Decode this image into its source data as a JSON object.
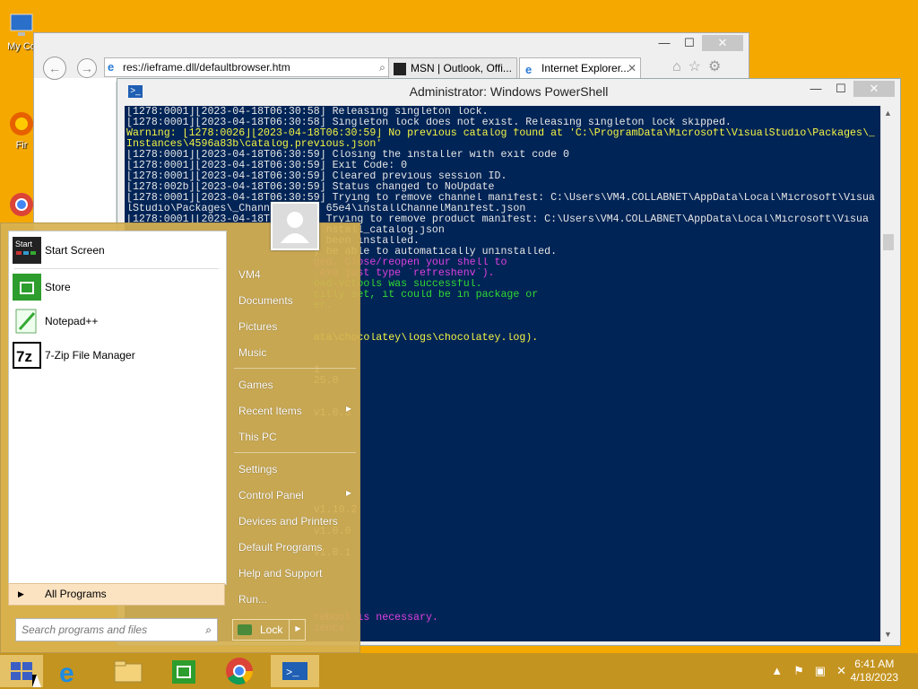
{
  "desktop": {
    "icons": [
      {
        "label": "My Co"
      },
      {
        "label": "Fir"
      }
    ]
  },
  "ie": {
    "address": "res://ieframe.dll/defaultbrowser.htm",
    "tabs": [
      {
        "label": "MSN | Outlook, Offi..."
      },
      {
        "label": "Internet Explorer..."
      }
    ]
  },
  "powershell": {
    "title": "Administrator: Windows PowerShell",
    "lines": [
      {
        "c": "w",
        "t": "[1278:0001][2023-04-18T06:30:58] Releasing singleton lock."
      },
      {
        "c": "w",
        "t": "[1278:0001][2023-04-18T06:30:58] Singleton lock does not exist. Releasing singleton lock skipped."
      },
      {
        "c": "y",
        "t": "Warning: [1278:0026][2023-04-18T06:30:59] No previous catalog found at 'C:\\ProgramData\\Microsoft\\VisualStudio\\Packages\\_"
      },
      {
        "c": "y",
        "t": "Instances\\4596a83b\\catalog.previous.json'"
      },
      {
        "c": "w",
        "t": "[1278:0001][2023-04-18T06:30:59] Closing the installer with exit code 0"
      },
      {
        "c": "w",
        "t": "[1278:0001][2023-04-18T06:30:59] Exit Code: 0"
      },
      {
        "c": "w",
        "t": "[1278:0001][2023-04-18T06:30:59] Cleared previous session ID."
      },
      {
        "c": "w",
        "t": "[1278:002b][2023-04-18T06:30:59] Status changed to NoUpdate"
      },
      {
        "c": "w",
        "t": "[1278:0001][2023-04-18T06:30:59] Trying to remove channel manifest: C:\\Users\\VM4.COLLABNET\\AppData\\Local\\Microsoft\\Visua"
      },
      {
        "c": "w",
        "t": "lStudio\\Packages\\_Chann         65e4\\installChannelManifest.json"
      },
      {
        "c": "w",
        "t": "[1278:0001][2023-04-18T         Trying to remove product manifest: C:\\Users\\VM4.COLLABNET\\AppData\\Local\\Microsoft\\Visua"
      },
      {
        "c": "w",
        "t": "                                nstall_catalog.json"
      },
      {
        "c": "w",
        "t": "                                been installed."
      },
      {
        "c": "w",
        "t": "                              y be able to automatically uninstalled."
      },
      {
        "c": "m",
        "t": "                              ged. Close/reopen your shell to"
      },
      {
        "c": "m",
        "t": "                              .exe just type `refreshenv`)."
      },
      {
        "c": "g",
        "t": "                              oad-vctools was successful."
      },
      {
        "c": "g",
        "t": "                              citly set, it could be in package or"
      },
      {
        "c": "g",
        "t": "                              er."
      },
      {
        "c": "w",
        "t": ""
      },
      {
        "c": "w",
        "t": ""
      },
      {
        "c": "y",
        "t": "                              ata\\chocolatey\\logs\\chocolatey.log)."
      },
      {
        "c": "w",
        "t": ""
      },
      {
        "c": "w",
        "t": ""
      },
      {
        "c": "w",
        "t": "                              1"
      },
      {
        "c": "w",
        "t": "                              25.0"
      },
      {
        "c": "w",
        "t": ""
      },
      {
        "c": "w",
        "t": ""
      },
      {
        "c": "w",
        "t": "                              v1.0.5"
      },
      {
        "c": "w",
        "t": ""
      },
      {
        "c": "w",
        "t": ""
      },
      {
        "c": "w",
        "t": ""
      },
      {
        "c": "w",
        "t": ""
      },
      {
        "c": "w",
        "t": ""
      },
      {
        "c": "w",
        "t": ""
      },
      {
        "c": "w",
        "t": ""
      },
      {
        "c": "w",
        "t": ""
      },
      {
        "c": "w",
        "t": "                              v1.10.2"
      },
      {
        "c": "w",
        "t": ""
      },
      {
        "c": "w",
        "t": "                              v1.0.0"
      },
      {
        "c": "w",
        "t": ""
      },
      {
        "c": "w",
        "t": "                              v1.0.1"
      },
      {
        "c": "w",
        "t": ""
      },
      {
        "c": "w",
        "t": ""
      },
      {
        "c": "w",
        "t": ""
      },
      {
        "c": "w",
        "t": ""
      },
      {
        "c": "w",
        "t": ""
      },
      {
        "c": "m",
        "t": "                              reboot is necessary."
      },
      {
        "c": "m",
        "t": "                              ience."
      }
    ]
  },
  "start_menu": {
    "pinned": [
      {
        "label": "Start Screen"
      },
      {
        "label": "Store"
      },
      {
        "label": "Notepad++"
      },
      {
        "label": "7-Zip File Manager"
      }
    ],
    "all_programs": "All Programs",
    "search_placeholder": "Search programs and files",
    "right_items": [
      {
        "label": "VM4"
      },
      {
        "label": "Documents"
      },
      {
        "label": "Pictures"
      },
      {
        "label": "Music"
      },
      {
        "label": "Games"
      },
      {
        "label": "Recent Items"
      },
      {
        "label": "This PC"
      },
      {
        "label": "Settings"
      },
      {
        "label": "Control Panel"
      },
      {
        "label": "Devices and Printers"
      },
      {
        "label": "Default Programs"
      },
      {
        "label": "Help and Support"
      },
      {
        "label": "Run..."
      }
    ],
    "lock_label": "Lock"
  },
  "taskbar": {
    "time": "6:41 AM",
    "date": "4/18/2023"
  }
}
